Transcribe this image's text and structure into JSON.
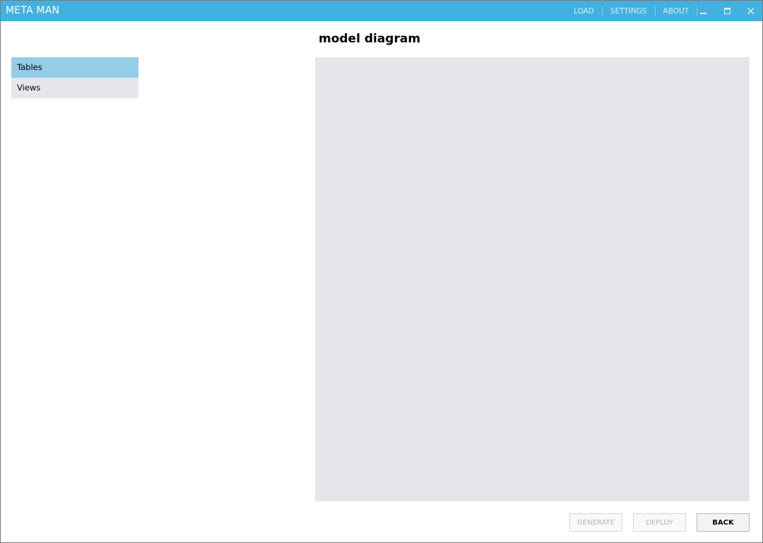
{
  "app": {
    "title": "META MAN"
  },
  "menu": {
    "load": "LOAD",
    "settings": "SETTINGS",
    "about": "ABOUT"
  },
  "window_controls": {
    "minimize": "minimize-icon",
    "maximize": "maximize-icon",
    "close": "close-icon"
  },
  "page": {
    "title": "model diagram"
  },
  "sidebar": {
    "items": [
      {
        "label": "Tables",
        "selected": true
      },
      {
        "label": "Views",
        "selected": false
      }
    ]
  },
  "footer": {
    "generate_label": "GENERATE",
    "deploy_label": "DEPLOY",
    "back_label": "BACK"
  },
  "colors": {
    "titlebar": "#41b1e1",
    "selected_item": "#95cde9",
    "canvas": "#e5e6e9"
  }
}
